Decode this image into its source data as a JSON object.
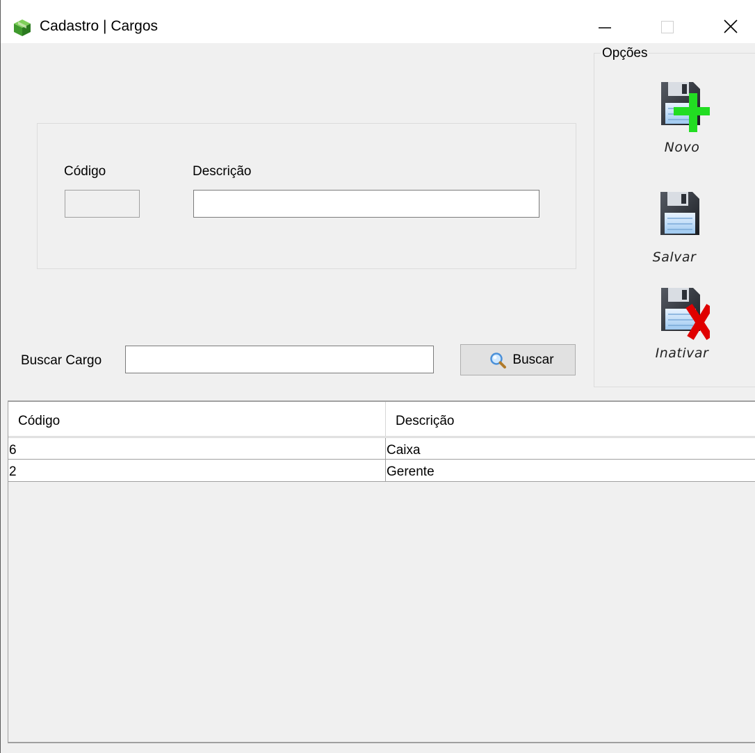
{
  "window": {
    "title": "Cadastro | Cargos",
    "icon": "green-box-icon"
  },
  "form": {
    "codigo_label": "Código",
    "codigo_value": "",
    "descricao_label": "Descrição",
    "descricao_value": ""
  },
  "search": {
    "label": "Buscar Cargo",
    "value": "",
    "button_label": "Buscar",
    "button_icon": "magnifier-icon"
  },
  "options": {
    "title": "Opções",
    "buttons": [
      {
        "label": "Novo",
        "icon": "floppy-plus-icon"
      },
      {
        "label": "Salvar",
        "icon": "floppy-icon"
      },
      {
        "label": "Inativar",
        "icon": "floppy-x-icon"
      }
    ]
  },
  "grid": {
    "columns": [
      "Código",
      "Descrição"
    ],
    "rows": [
      [
        "6",
        "Caixa"
      ],
      [
        "2",
        "Gerente"
      ]
    ]
  },
  "colors": {
    "accent_plus": "#22dd22",
    "accent_x": "#e00000",
    "window_bg": "#f0f0f0"
  }
}
